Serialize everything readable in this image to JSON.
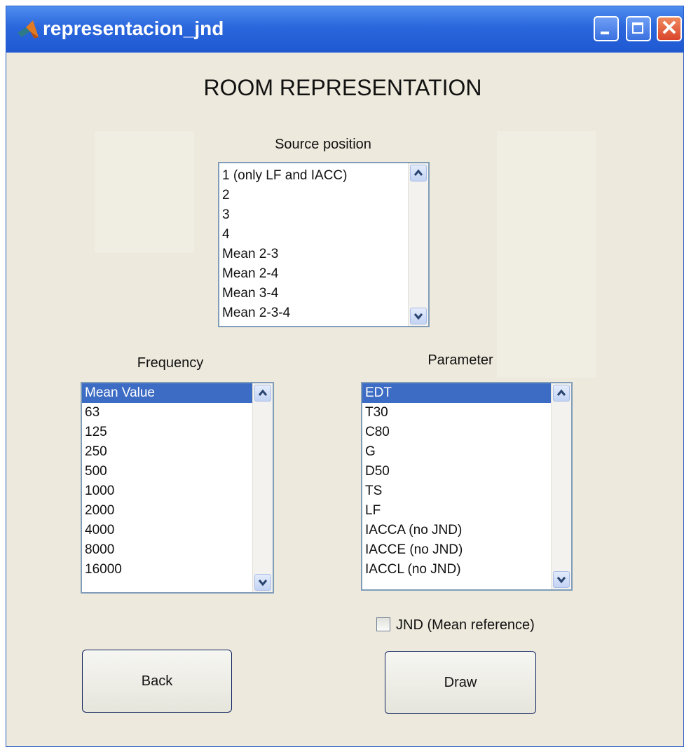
{
  "window": {
    "title": "representacion_jnd",
    "controls": {
      "minimize": "minimize-icon",
      "maximize": "maximize-icon",
      "close": "close-icon"
    }
  },
  "main": {
    "title": "ROOM REPRESENTATION"
  },
  "source_position": {
    "label": "Source position",
    "items": [
      "1 (only LF and IACC)",
      "2",
      "3",
      "4",
      "Mean 2-3",
      "Mean 2-4",
      "Mean 3-4",
      "Mean 2-3-4"
    ]
  },
  "frequency": {
    "label": "Frequency",
    "selected": "Mean Value",
    "items": [
      "Mean Value",
      "63",
      "125",
      "250",
      "500",
      "1000",
      "2000",
      "4000",
      "8000",
      "16000"
    ]
  },
  "parameter": {
    "label": "Parameter",
    "selected": "EDT",
    "items": [
      "EDT",
      "T30",
      "C80",
      "G",
      "D50",
      "TS",
      "LF",
      "IACCA (no JND)",
      "IACCE (no JND)",
      "IACCL (no JND)"
    ]
  },
  "jnd_checkbox": {
    "label": "JND (Mean reference)",
    "checked": false
  },
  "buttons": {
    "back": "Back",
    "draw": "Draw"
  },
  "colors": {
    "titlebar": "#2a66dc",
    "selection": "#3d6cc4",
    "background": "#ede9dc",
    "close": "#d9452c"
  }
}
